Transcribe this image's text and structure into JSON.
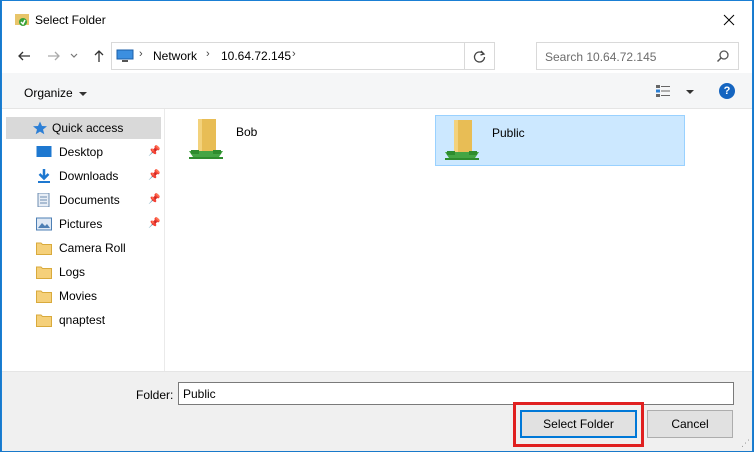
{
  "window": {
    "title": "Select Folder"
  },
  "address": {
    "crumbs": [
      "Network",
      "10.64.72.145"
    ]
  },
  "search": {
    "placeholder": "Search 10.64.72.145"
  },
  "toolbar": {
    "organize_label": "Organize"
  },
  "sidebar": {
    "items": [
      {
        "label": "Quick access",
        "icon": "star-icon",
        "pinned": false
      },
      {
        "label": "Desktop",
        "icon": "desktop-icon",
        "pinned": true
      },
      {
        "label": "Downloads",
        "icon": "download-icon",
        "pinned": true
      },
      {
        "label": "Documents",
        "icon": "documents-icon",
        "pinned": true
      },
      {
        "label": "Pictures",
        "icon": "pictures-icon",
        "pinned": true
      },
      {
        "label": "Camera Roll",
        "icon": "folder-icon",
        "pinned": false
      },
      {
        "label": "Logs",
        "icon": "folder-icon",
        "pinned": false
      },
      {
        "label": "Movies",
        "icon": "folder-icon",
        "pinned": false
      },
      {
        "label": "qnaptest",
        "icon": "folder-icon",
        "pinned": false
      }
    ]
  },
  "content": {
    "folders": [
      {
        "label": "Bob",
        "selected": false
      },
      {
        "label": "Public",
        "selected": true
      }
    ]
  },
  "footer": {
    "folder_label": "Folder:",
    "folder_value": "Public",
    "select_label": "Select Folder",
    "cancel_label": "Cancel"
  },
  "colors": {
    "accent": "#0078d7",
    "selection": "#cce8ff",
    "highlight": "#e02020"
  }
}
